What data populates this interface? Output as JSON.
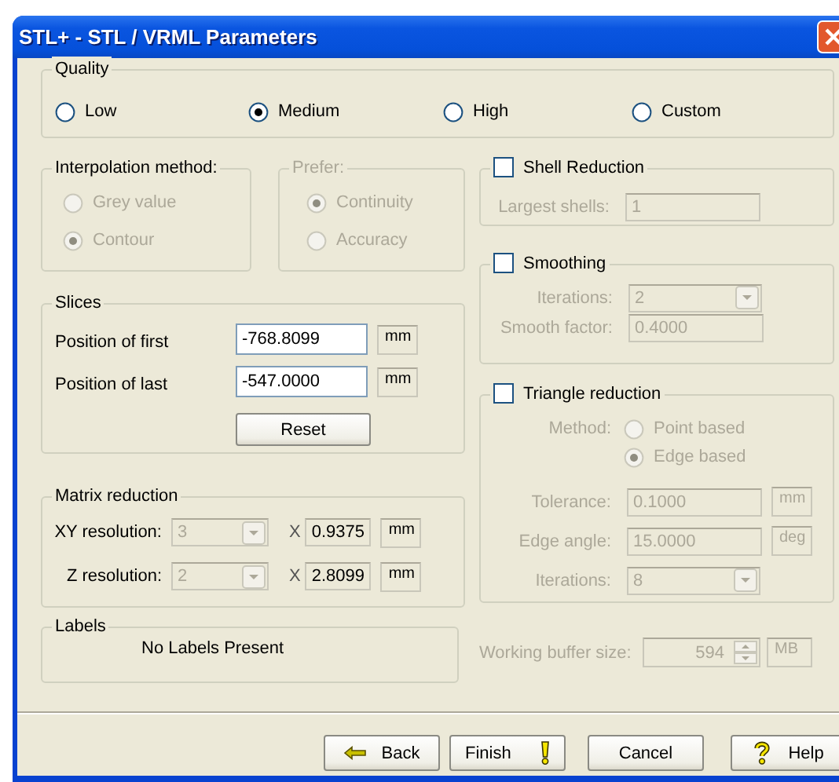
{
  "window": {
    "title": "STL+ - STL / VRML Parameters"
  },
  "quality": {
    "label": "Quality",
    "options": [
      {
        "label": "Low",
        "selected": false
      },
      {
        "label": "Medium",
        "selected": true
      },
      {
        "label": "High",
        "selected": false
      },
      {
        "label": "Custom",
        "selected": false
      }
    ]
  },
  "interpolation": {
    "label": "Interpolation method:",
    "disabled": false,
    "options": [
      {
        "label": "Grey value",
        "selected": false,
        "disabled": true
      },
      {
        "label": "Contour",
        "selected": true,
        "disabled": true
      }
    ]
  },
  "prefer": {
    "label": "Prefer:",
    "disabled": true,
    "options": [
      {
        "label": "Continuity",
        "selected": true,
        "disabled": true
      },
      {
        "label": "Accuracy",
        "selected": false,
        "disabled": true
      }
    ]
  },
  "slices": {
    "label": "Slices",
    "rows": [
      {
        "label": "Position of first",
        "value": "-768.8099",
        "unit": "mm"
      },
      {
        "label": "Position of last",
        "value": "-547.0000",
        "unit": "mm"
      }
    ],
    "reset_button": "Reset"
  },
  "matrix_reduction": {
    "label": "Matrix reduction",
    "rows": [
      {
        "label": "XY resolution:",
        "dropdown": "3",
        "disabled": true,
        "times": "X",
        "factor": "0.9375",
        "unit": "mm"
      },
      {
        "label": "Z resolution:",
        "dropdown": "2",
        "disabled": true,
        "times": "X",
        "factor": "2.8099",
        "unit": "mm"
      }
    ]
  },
  "labels": {
    "label": "Labels",
    "message": "No Labels Present"
  },
  "shell_reduction": {
    "label": "Shell Reduction",
    "checked": false,
    "fields": [
      {
        "kind": "text",
        "label": "Largest shells:",
        "value": "1",
        "disabled": true
      }
    ]
  },
  "smoothing": {
    "label": "Smoothing",
    "checked": false,
    "fields": [
      {
        "kind": "dropdown",
        "label": "Iterations:",
        "value": "2",
        "disabled": true
      },
      {
        "kind": "text",
        "label": "Smooth factor:",
        "value": "0.4000",
        "disabled": true
      }
    ]
  },
  "triangle_reduction": {
    "label": "Triangle reduction",
    "checked": false,
    "method": {
      "label": "Method:",
      "disabled": true,
      "options": [
        {
          "label": "Point based",
          "selected": false,
          "disabled": true
        },
        {
          "label": "Edge based",
          "selected": true,
          "disabled": true
        }
      ]
    },
    "fields": [
      {
        "kind": "text",
        "label": "Tolerance:",
        "value": "0.1000",
        "unit": "mm",
        "disabled": true
      },
      {
        "kind": "text",
        "label": "Edge angle:",
        "value": "15.0000",
        "unit": "deg",
        "disabled": true
      },
      {
        "kind": "dropdown",
        "label": "Iterations:",
        "value": "8",
        "disabled": true
      }
    ]
  },
  "working_buffer": {
    "label": "Working buffer size:",
    "value": "594",
    "unit": "MB",
    "disabled": true
  },
  "buttons": [
    {
      "kind": "back",
      "label": "Back"
    },
    {
      "kind": "finish",
      "label": "Finish"
    },
    {
      "kind": "cancel",
      "label": "Cancel"
    },
    {
      "kind": "help",
      "label": "Help"
    }
  ]
}
